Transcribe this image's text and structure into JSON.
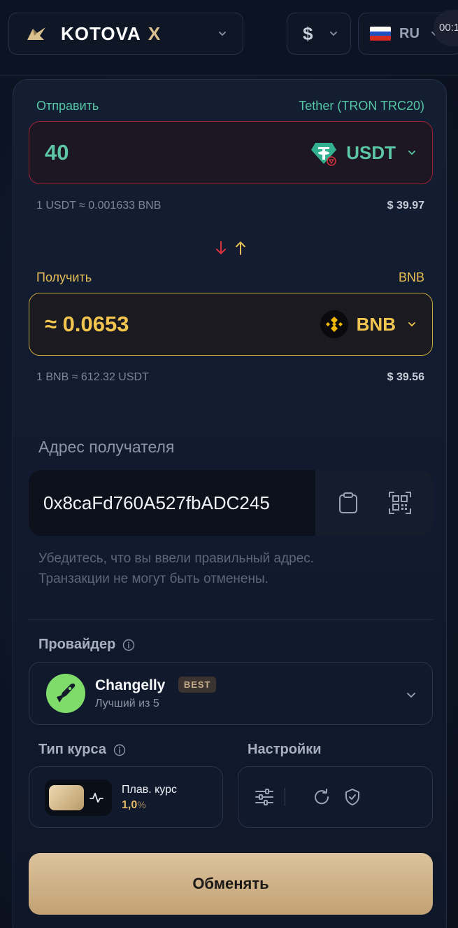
{
  "header": {
    "brand_name": "KOTOVA",
    "brand_suffix": "X",
    "currency_sign": "$",
    "language": "RU",
    "timer": "00:1"
  },
  "send": {
    "label": "Отправить",
    "network": "Tether (TRON TRC20)",
    "amount": "40",
    "coin": "USDT",
    "rate": "1 USDT ≈ 0.001633 BNB",
    "usd": "$ 39.97"
  },
  "receive": {
    "label": "Получить",
    "network": "BNB",
    "amount": "≈ 0.0653",
    "coin": "BNB",
    "rate": "1 BNB ≈ 612.32 USDT",
    "usd": "$ 39.56"
  },
  "address": {
    "title": "Адрес получателя",
    "value": "0x8caFd760A527fbADC245",
    "warning_line1": "Убедитесь, что вы ввели правильный адрес.",
    "warning_line2": "Транзакции не могут быть отменены."
  },
  "provider": {
    "title": "Провайдер",
    "name": "Changelly",
    "badge": "BEST",
    "subtitle": "Лучший из 5"
  },
  "rate_type": {
    "title": "Тип курса",
    "name": "Плав. курс",
    "value": "1,0",
    "unit": "%"
  },
  "settings": {
    "title": "Настройки"
  },
  "exchange_button": "Обменять",
  "colors": {
    "send_accent": "#5cc6a6",
    "receive_accent": "#f2c550",
    "button_gold": "#d4b78c"
  }
}
